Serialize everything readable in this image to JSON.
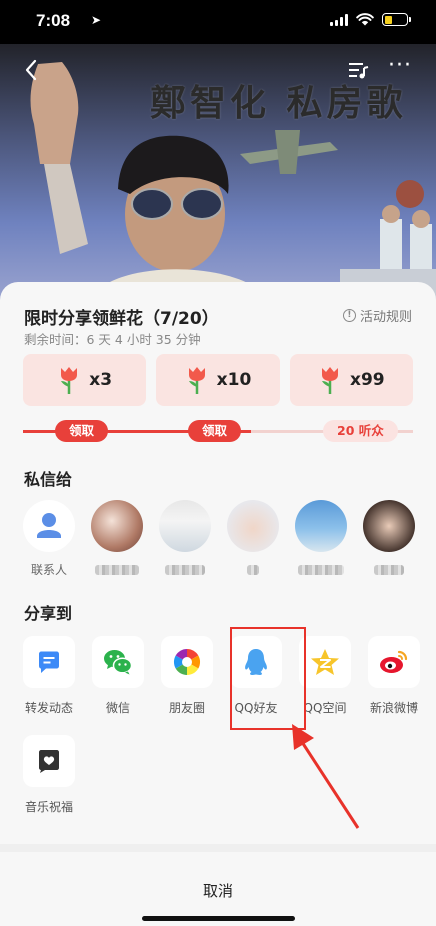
{
  "status_bar": {
    "time": "7:08",
    "location_glyph": "➤"
  },
  "player": {
    "album_title": "鄭智化 私房歌",
    "back_icon": "chevron-left-icon",
    "playlist_icon": "playlist-icon",
    "more_icon": "more-icon"
  },
  "promo": {
    "title": "限时分享领鲜花（7/20）",
    "rules_label": "活动规则",
    "time_remaining": "剩余时间：6 天 4 小时 35 分钟",
    "rewards": [
      {
        "icon": "rose-icon",
        "count": "x3"
      },
      {
        "icon": "rose-icon",
        "count": "x10"
      },
      {
        "icon": "rose-icon",
        "count": "x99"
      }
    ],
    "milestones": [
      "领取",
      "领取",
      "20 听众"
    ]
  },
  "private_message": {
    "title": "私信给",
    "contacts": [
      {
        "name": "联系人"
      }
    ]
  },
  "share_to": {
    "title": "分享到",
    "targets": [
      {
        "label": "转发动态",
        "icon": "repost-icon"
      },
      {
        "label": "微信",
        "icon": "wechat-icon"
      },
      {
        "label": "朋友圈",
        "icon": "moments-icon"
      },
      {
        "label": "QQ好友",
        "icon": "qq-icon"
      },
      {
        "label": "QQ空间",
        "icon": "qzone-icon"
      },
      {
        "label": "新浪微博",
        "icon": "weibo-icon"
      },
      {
        "label": "音乐祝福",
        "icon": "music-greeting-icon"
      }
    ]
  },
  "cancel_label": "取消",
  "colors": {
    "accent_red": "#e8403a",
    "reward_bg": "#fae4e1",
    "sheet_bg": "#f7f7f7",
    "annotation_red": "#e8322a"
  }
}
